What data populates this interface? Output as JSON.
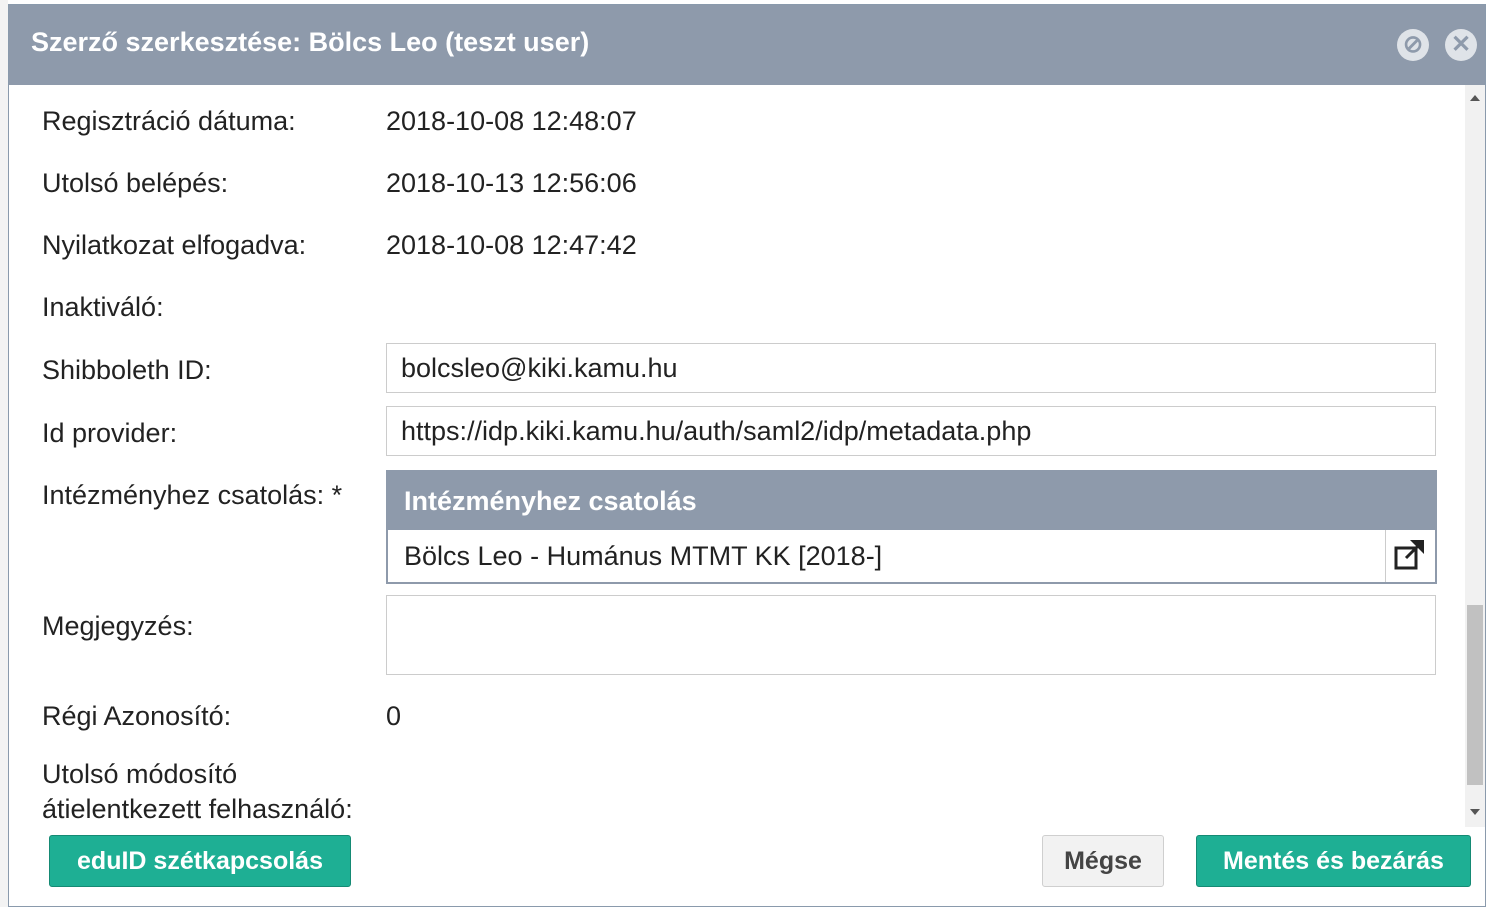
{
  "dialog": {
    "title": "Szerző szerkesztése: Bölcs Leo (teszt user)",
    "hide_icon": "⊘",
    "close_icon": "✕"
  },
  "fields": {
    "registration_label": "Regisztráció dátuma:",
    "registration_value": "2018-10-08 12:48:07",
    "last_login_label": "Utolsó belépés:",
    "last_login_value": "2018-10-13 12:56:06",
    "declaration_label": "Nyilatkozat elfogadva:",
    "declaration_value": "2018-10-08 12:47:42",
    "inactivator_label": "Inaktiváló:",
    "shibboleth_label": "Shibboleth ID:",
    "shibboleth_value": "bolcsleo@kiki.kamu.hu",
    "idp_label": "Id provider:",
    "idp_value": "https://idp.kiki.kamu.hu/auth/saml2/idp/metadata.php",
    "institution_label": "Intézményhez csatolás:",
    "required_mark": "*",
    "institution_header": "Intézményhez csatolás",
    "institution_row": "Bölcs Leo - Humánus MTMT KK [2018-]",
    "note_label": "Megjegyzés:",
    "note_value": "",
    "old_id_label": "Régi Azonosító:",
    "old_id_value": "0",
    "last_modifier_label_line1": "Utolsó módosító",
    "last_modifier_label_line2": "átielentkezett felhasználó:"
  },
  "buttons": {
    "eduid": "eduID szétkapcsolás",
    "cancel": "Mégse",
    "save_close": "Mentés és bezárás"
  },
  "colors": {
    "header": "#8e9aab",
    "accent": "#1eaf94"
  }
}
